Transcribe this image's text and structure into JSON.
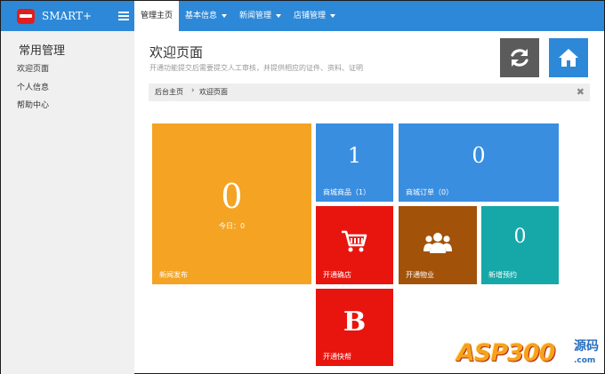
{
  "brand": {
    "name": "SMART+"
  },
  "nav": [
    {
      "label": "管理主页",
      "active": true,
      "dropdown": false
    },
    {
      "label": "基本信息",
      "active": false,
      "dropdown": true
    },
    {
      "label": "新闻管理",
      "active": false,
      "dropdown": true
    },
    {
      "label": "店铺管理",
      "active": false,
      "dropdown": true
    }
  ],
  "sidebar": {
    "title": "常用管理",
    "items": [
      "欢迎页面",
      "个人信息",
      "帮助中心"
    ]
  },
  "page": {
    "title": "欢迎页面",
    "subtitle": "开通功能提交后需要提交人工审核，并提供相应的证件、资料、证明"
  },
  "breadcrumb": {
    "home": "后台主页",
    "separator": "›",
    "current": "欢迎页面",
    "close": "✖"
  },
  "tiles": {
    "news": {
      "value": "0",
      "sub": "今日：0",
      "label": "新闻发布",
      "color": "#f4a323"
    },
    "products": {
      "value": "1",
      "label": "商城商品（1）",
      "color": "#3a8ee0"
    },
    "orders": {
      "value": "0",
      "label": "商城订单（0）",
      "color": "#3a8ee0"
    },
    "shop": {
      "label": "开通确店",
      "icon": "shopping-cart-icon",
      "color": "#e8150f"
    },
    "property": {
      "label": "开通物业",
      "icon": "users-icon",
      "color": "#a3520a"
    },
    "booking": {
      "value": "0",
      "label": "新增预约",
      "color": "#16a8a8"
    },
    "express": {
      "glyph": "B",
      "label": "开通快帮",
      "color": "#e8150f"
    }
  },
  "watermark": {
    "text": "ASP300",
    "suffix": "源码",
    "domain": ".com"
  },
  "colors": {
    "primary": "#2d89d8",
    "sidebar_bg": "#f0f0f0",
    "refresh_btn": "#5b5b5b"
  }
}
